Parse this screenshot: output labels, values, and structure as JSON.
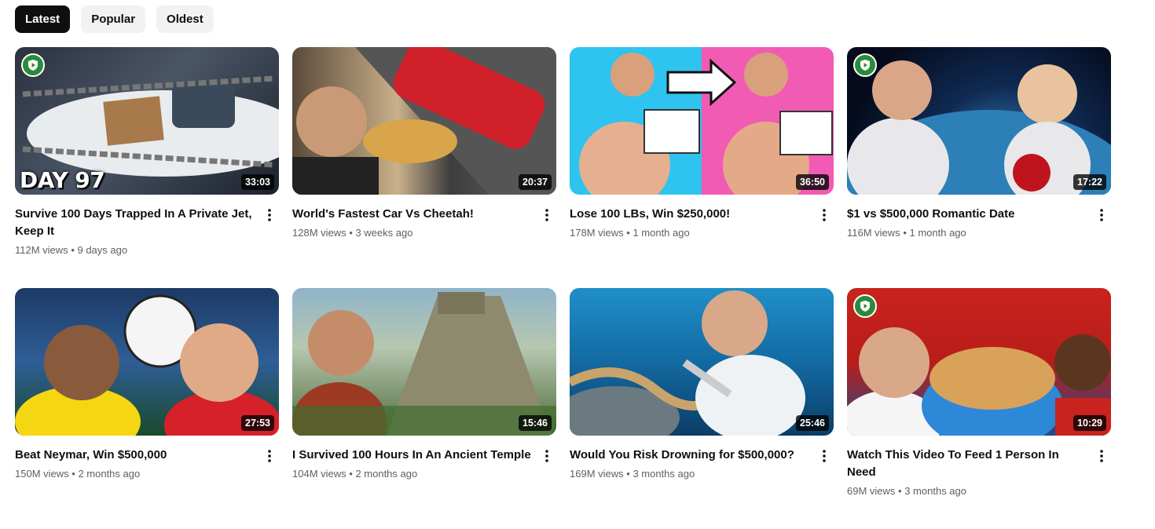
{
  "filters": [
    {
      "label": "Latest",
      "active": true
    },
    {
      "label": "Popular",
      "active": false
    },
    {
      "label": "Oldest",
      "active": false
    }
  ],
  "videos": [
    {
      "title": "Survive 100 Days Trapped In A Private Jet, Keep It",
      "views": "112M views",
      "age": "9 days ago",
      "duration": "33:03",
      "overlay": "DAY 97",
      "member_badge": true
    },
    {
      "title": "World's Fastest Car Vs Cheetah!",
      "views": "128M views",
      "age": "3 weeks ago",
      "duration": "20:37",
      "overlay": "",
      "member_badge": false
    },
    {
      "title": "Lose 100 LBs, Win $250,000!",
      "views": "178M views",
      "age": "1 month ago",
      "duration": "36:50",
      "overlay": "",
      "member_badge": false
    },
    {
      "title": "$1 vs $500,000 Romantic Date",
      "views": "116M views",
      "age": "1 month ago",
      "duration": "17:22",
      "overlay": "",
      "member_badge": true
    },
    {
      "title": "Beat Neymar, Win $500,000",
      "views": "150M views",
      "age": "2 months ago",
      "duration": "27:53",
      "overlay": "",
      "member_badge": false
    },
    {
      "title": "I Survived 100 Hours In An Ancient Temple",
      "views": "104M views",
      "age": "2 months ago",
      "duration": "15:46",
      "overlay": "",
      "member_badge": false
    },
    {
      "title": "Would You Risk Drowning for $500,000?",
      "views": "169M views",
      "age": "3 months ago",
      "duration": "25:46",
      "overlay": "",
      "member_badge": false
    },
    {
      "title": "Watch This Video To Feed 1 Person In Need",
      "views": "69M views",
      "age": "3 months ago",
      "duration": "10:29",
      "overlay": "",
      "member_badge": true
    }
  ],
  "separator": "•",
  "icons": {
    "more": "more-vert-icon",
    "member": "members-only-icon"
  },
  "colors": {
    "chip_active_bg": "#0f0f0f",
    "chip_bg": "#f2f2f2",
    "meta_text": "#606060",
    "member_badge": "#2c8a3c"
  }
}
